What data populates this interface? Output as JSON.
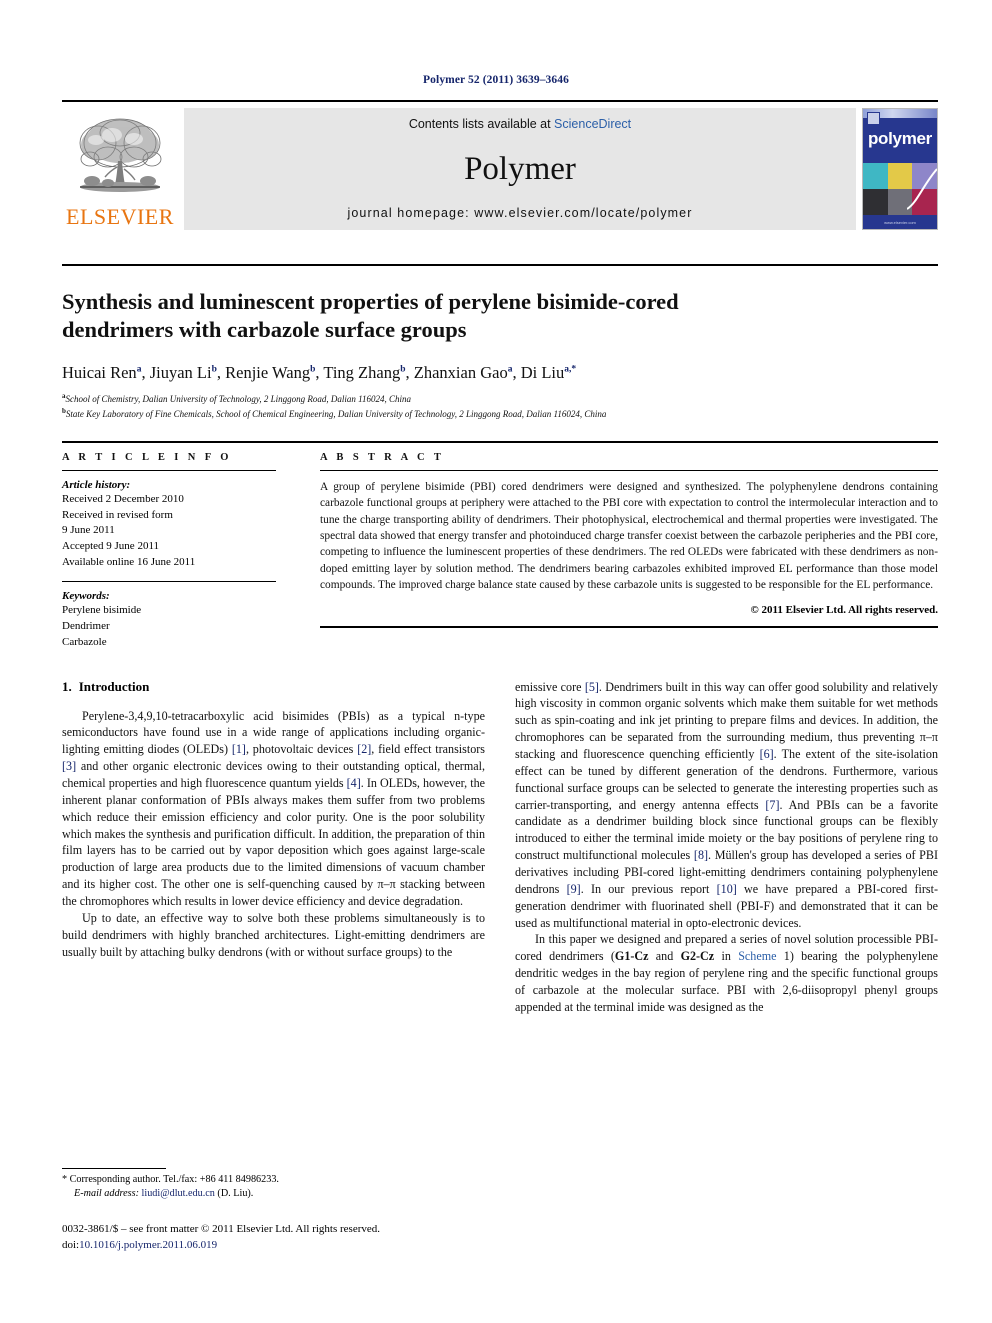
{
  "running_head": "Polymer 52 (2011) 3639–3646",
  "masthead": {
    "publisher_name": "ELSEVIER",
    "contents_prefix": "Contents lists available at ",
    "contents_link": "ScienceDirect",
    "journal_name": "Polymer",
    "homepage": "journal homepage: www.elsevier.com/locate/polymer",
    "cover_title": "polymer",
    "cover_footer": "www.elsevier.com"
  },
  "article": {
    "title": "Synthesis and luminescent properties of perylene bisimide-cored dendrimers with carbazole surface groups",
    "authors": [
      {
        "name": "Huicai Ren",
        "sup": "a",
        "sep": ", "
      },
      {
        "name": "Jiuyan Li",
        "sup": "b",
        "sep": ", "
      },
      {
        "name": "Renjie Wang",
        "sup": "b",
        "sep": ", "
      },
      {
        "name": "Ting Zhang",
        "sup": "b",
        "sep": ", "
      },
      {
        "name": "Zhanxian Gao",
        "sup": "a",
        "sep": ", "
      },
      {
        "name": "Di Liu",
        "sup": "a,*",
        "sep": ""
      }
    ],
    "affiliations": [
      {
        "mark": "a",
        "text": "School of Chemistry, Dalian University of Technology, 2 Linggong Road, Dalian 116024, China"
      },
      {
        "mark": "b",
        "text": "State Key Laboratory of Fine Chemicals, School of Chemical Engineering, Dalian University of Technology, 2 Linggong Road, Dalian 116024, China"
      }
    ]
  },
  "info": {
    "heading": "A R T I C L E   I N F O",
    "history_label": "Article history:",
    "history": [
      "Received 2 December 2010",
      "Received in revised form",
      "9 June 2011",
      "Accepted 9 June 2011",
      "Available online 16 June 2011"
    ],
    "keywords_label": "Keywords:",
    "keywords": [
      "Perylene bisimide",
      "Dendrimer",
      "Carbazole"
    ]
  },
  "abstract": {
    "heading": "A B S T R A C T",
    "text": "A group of perylene bisimide (PBI) cored dendrimers were designed and synthesized. The polyphenylene dendrons containing carbazole functional groups at periphery were attached to the PBI core with expectation to control the intermolecular interaction and to tune the charge transporting ability of dendrimers. Their photophysical, electrochemical and thermal properties were investigated. The spectral data showed that energy transfer and photoinduced charge transfer coexist between the carbazole peripheries and the PBI core, competing to influence the luminescent properties of these dendrimers. The red OLEDs were fabricated with these dendrimers as non-doped emitting layer by solution method. The dendrimers bearing carbazoles exhibited improved EL performance than those model compounds. The improved charge balance state caused by these carbazole units is suggested to be responsible for the EL performance.",
    "copyright": "© 2011 Elsevier Ltd. All rights reserved."
  },
  "sections": {
    "intro_number": "1.",
    "intro_title": "Introduction"
  },
  "body": {
    "left_paragraphs": [
      {
        "parts": [
          {
            "t": "Perylene-3,4,9,10-tetracarboxylic acid bisimides (PBIs) as a typical n-type semiconductors have found use in a wide range of applications including organic-lighting emitting diodes (OLEDs) ",
            "s": "n"
          },
          {
            "t": "[1]",
            "s": "ref"
          },
          {
            "t": ", photovoltaic devices ",
            "s": "n"
          },
          {
            "t": "[2]",
            "s": "ref"
          },
          {
            "t": ", field effect transistors ",
            "s": "n"
          },
          {
            "t": "[3]",
            "s": "ref"
          },
          {
            "t": " and other organic electronic devices owing to their outstanding optical, thermal, chemical properties and high fluorescence quantum yields ",
            "s": "n"
          },
          {
            "t": "[4]",
            "s": "ref"
          },
          {
            "t": ". In OLEDs, however, the inherent planar conformation of PBIs always makes them suffer from two problems which reduce their emission efficiency and color purity. One is the poor solubility which makes the synthesis and purification difficult. In addition, the preparation of thin film layers has to be carried out by vapor deposition which goes against large-scale production of large area products due to the limited dimensions of vacuum chamber and its higher cost. The other one is self-quenching caused by π–π stacking between the chromophores which results in lower device efficiency and device degradation.",
            "s": "n"
          }
        ]
      },
      {
        "parts": [
          {
            "t": "Up to date, an effective way to solve both these problems simultaneously is to build dendrimers with highly branched architectures. Light-emitting dendrimers are usually built by attaching bulky dendrons (with or without surface groups) to the",
            "s": "n"
          }
        ]
      }
    ],
    "right_paragraphs": [
      {
        "indent": false,
        "parts": [
          {
            "t": "emissive core ",
            "s": "n"
          },
          {
            "t": "[5]",
            "s": "ref"
          },
          {
            "t": ". Dendrimers built in this way can offer good solubility and relatively high viscosity in common organic solvents which make them suitable for wet methods such as spin-coating and ink jet printing to prepare films and devices. In addition, the chromophores can be separated from the surrounding medium, thus preventing π–π stacking and fluorescence quenching efficiently ",
            "s": "n"
          },
          {
            "t": "[6]",
            "s": "ref"
          },
          {
            "t": ". The extent of the site-isolation effect can be tuned by different generation of the dendrons. Furthermore, various functional surface groups can be selected to generate the interesting properties such as carrier-transporting, and energy antenna effects ",
            "s": "n"
          },
          {
            "t": "[7]",
            "s": "ref"
          },
          {
            "t": ". And PBIs can be a favorite candidate as a dendrimer building block since functional groups can be flexibly introduced to either the terminal imide moiety or the bay positions of perylene ring to construct multifunctional molecules ",
            "s": "n"
          },
          {
            "t": "[8]",
            "s": "ref"
          },
          {
            "t": ". Müllen's group has developed a series of PBI derivatives including PBI-cored light-emitting dendrimers containing polyphenylene dendrons ",
            "s": "n"
          },
          {
            "t": "[9]",
            "s": "ref"
          },
          {
            "t": ". In our previous report ",
            "s": "n"
          },
          {
            "t": "[10]",
            "s": "ref"
          },
          {
            "t": " we have prepared a PBI-cored first-generation dendrimer with fluorinated shell (PBI-F) and demonstrated that it can be used as multifunctional material in opto-electronic devices.",
            "s": "n"
          }
        ]
      },
      {
        "indent": true,
        "parts": [
          {
            "t": "In this paper we designed and prepared a series of novel solution processible PBI-cored dendrimers (",
            "s": "n"
          },
          {
            "t": "G1-Cz",
            "s": "b"
          },
          {
            "t": " and ",
            "s": "n"
          },
          {
            "t": "G2-Cz",
            "s": "b"
          },
          {
            "t": " in ",
            "s": "n"
          },
          {
            "t": "Scheme",
            "s": "lnk"
          },
          {
            "t": " 1) bearing the polyphenylene dendritic wedges in the bay region of perylene ring and the specific functional groups of carbazole at the molecular surface. PBI with 2,6-diisopropyl phenyl groups appended at the terminal imide was designed as the",
            "s": "n"
          }
        ]
      }
    ]
  },
  "footnotes": {
    "corresponding": "* Corresponding author. Tel./fax: +86 411 84986233.",
    "email_label": "E-mail address:",
    "email": "liudi@dlut.edu.cn",
    "email_suffix": "(D. Liu).",
    "issn_line": "0032-3861/$ – see front matter © 2011 Elsevier Ltd. All rights reserved.",
    "doi_label": "doi:",
    "doi_value": "10.1016/j.polymer.2011.06.019"
  },
  "colors": {
    "link_blue": "#2b5fa8",
    "ref_blue": "#15256b",
    "elsevier_orange": "#e87511",
    "cover_navy": "#27378f",
    "banner_gray": "#e6e6e6"
  }
}
